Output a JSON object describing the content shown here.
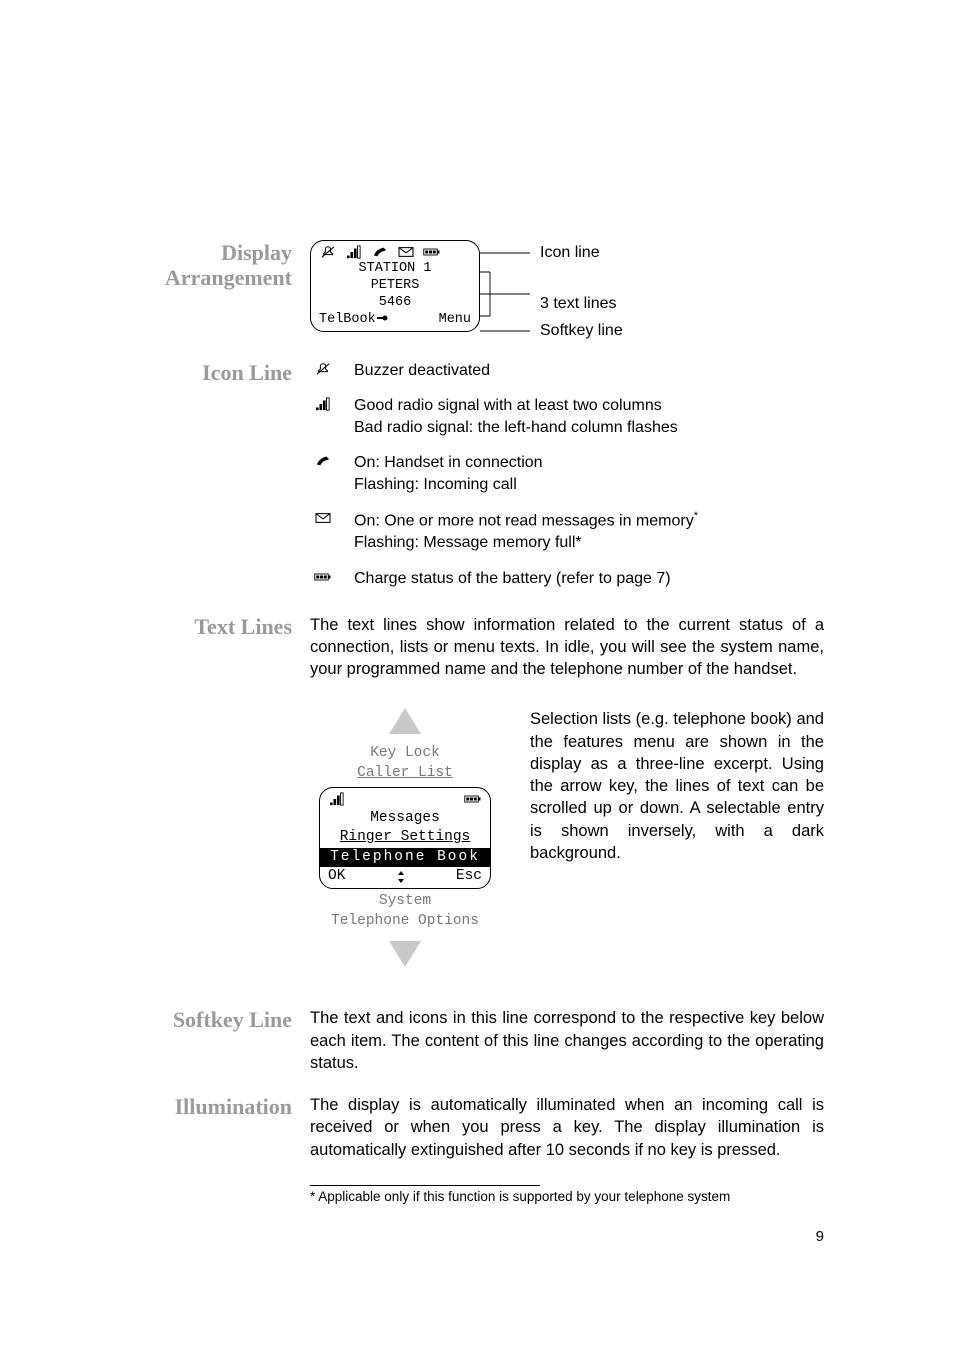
{
  "labels": {
    "display_arrangement": "Display\nArrangement",
    "icon_line": "Icon Line",
    "text_lines": "Text Lines",
    "softkey_line": "Softkey Line",
    "illumination": "Illumination"
  },
  "display_fig": {
    "text1": "STATION 1",
    "text2": "PETERS",
    "text3": "5466",
    "soft_left": "TelBook",
    "soft_right": "Menu",
    "callout_icon": "Icon line",
    "callout_text": "3 text lines",
    "callout_soft": "Softkey line"
  },
  "icon_descriptions": {
    "buzzer": "Buzzer deactivated",
    "signal_line1": "Good radio signal with at least two columns",
    "signal_line2": "Bad radio signal: the left-hand column flashes",
    "hook_line1": "On: Handset in connection",
    "hook_line2": "Flashing: Incoming call",
    "msg_line1_a": "On: One or more not read messages in memory",
    "msg_line1_b": "*",
    "msg_line2": "Flashing: Message memory full*",
    "battery": "Charge status of the battery (refer to page 7)"
  },
  "text_lines_para": "The text lines show information related to the current status of a connection, lists or menu texts. In idle, you will see the system name, your programmed name and the telephone number of the handset.",
  "scroll_list": {
    "above1": "Key Lock",
    "above2": "Caller List",
    "row1": "Messages",
    "row2": "Ringer Settings",
    "row3": "Telephone Book",
    "soft_left": "OK",
    "soft_right": "Esc",
    "below1": "System",
    "below2": "Telephone Options"
  },
  "scroll_para": "Selection lists (e.g. telephone book) and the features menu are shown in the display as a three-line excerpt. Using the arrow key, the lines of text can be scrolled up or down. A selectable entry is shown inversely, with a dark background.",
  "softkey_para": "The text and icons in this line correspond to the respective key below each item. The content of this line changes according to the operating status.",
  "illumination_para": "The display is automatically illuminated when an incoming call is received or when you press a key. The display illumination is automatically extinguished after 10 seconds if no key is pressed.",
  "footnote": "*  Applicable only if this function is supported by your telephone system",
  "page_number": "9"
}
